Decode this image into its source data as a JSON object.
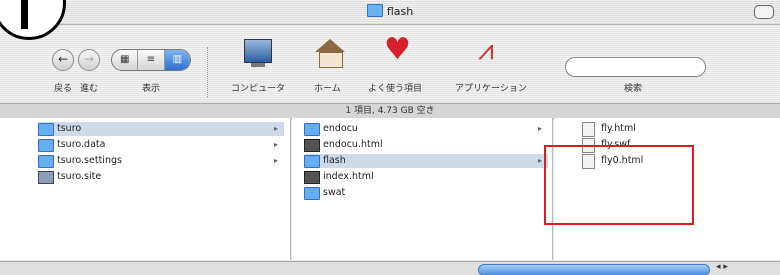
{
  "window": {
    "title": "flash"
  },
  "annotation": {
    "step_number": "1"
  },
  "toolbar": {
    "back_label": "戻る",
    "forward_label": "進む",
    "view_label": "表示",
    "tools": [
      {
        "label": "コンピュータ",
        "icon": "computer-icon"
      },
      {
        "label": "ホーム",
        "icon": "home-icon"
      },
      {
        "label": "よく使う項目",
        "icon": "favorites-heart-icon"
      },
      {
        "label": "アプリケーション",
        "icon": "applications-icon"
      }
    ],
    "search_label": "検索",
    "search_value": ""
  },
  "status": {
    "text": "1 項目, 4.73 GB 空き"
  },
  "columns": {
    "col1": [
      {
        "name": "tsuro",
        "icon": "folder",
        "arrow": true,
        "selected": true
      },
      {
        "name": "tsuro.data",
        "icon": "folder",
        "arrow": true,
        "selected": false
      },
      {
        "name": "tsuro.settings",
        "icon": "folder",
        "arrow": true,
        "selected": false
      },
      {
        "name": "tsuro.site",
        "icon": "site",
        "arrow": false,
        "selected": false
      }
    ],
    "col2": [
      {
        "name": "endocu",
        "icon": "folder",
        "arrow": true,
        "selected": false
      },
      {
        "name": "endocu.html",
        "icon": "docdark",
        "arrow": false,
        "selected": false
      },
      {
        "name": "flash",
        "icon": "folder",
        "arrow": true,
        "selected": true
      },
      {
        "name": "index.html",
        "icon": "docdark",
        "arrow": false,
        "selected": false
      },
      {
        "name": "swat",
        "icon": "folder",
        "arrow": false,
        "selected": false
      }
    ],
    "col3": [
      {
        "name": "fly.html",
        "icon": "doc"
      },
      {
        "name": "fly.swf",
        "icon": "doc"
      },
      {
        "name": "fly0.html",
        "icon": "doc"
      }
    ]
  },
  "colors": {
    "annotation_red": "#d42020",
    "selection": "#cfd9e8"
  }
}
